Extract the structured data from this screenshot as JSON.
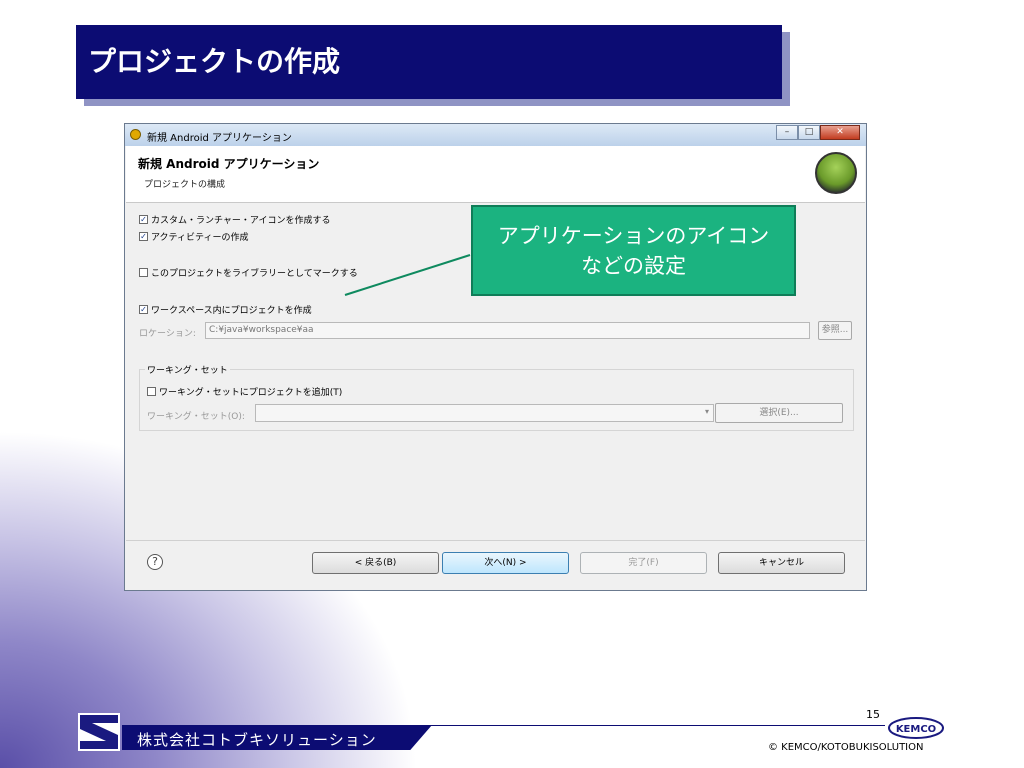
{
  "slide": {
    "title": "プロジェクトの作成",
    "page_number": "15",
    "company_name": "株式会社コトブキソリューション",
    "copyright": "© KEMCO/KOTOBUKISOLUTION",
    "kemco_logo_text": "KEMCO"
  },
  "dialog": {
    "window_title": "新規 Android アプリケーション",
    "window_buttons": {
      "minimize": "–",
      "maximize": "□",
      "close": "✕"
    },
    "banner_title": "新規 Android アプリケーション",
    "banner_subtitle": "プロジェクトの構成",
    "options": {
      "custom_icon": "カスタム・ランチャー・アイコンを作成する",
      "activity": "アクティビティーの作成",
      "library": "このプロジェクトをライブラリーとしてマークする",
      "workspace": "ワークスペース内にプロジェクトを作成"
    },
    "location_label": "ロケーション:",
    "location_value": "C:¥java¥workspace¥aa",
    "browse_label": "参照...",
    "working_set_group": "ワーキング・セット",
    "working_set_add": "ワーキング・セットにプロジェクトを追加(T)",
    "working_set_label": "ワーキング・セット(O):",
    "select_label": "選択(E)...",
    "help_symbol": "?",
    "buttons": {
      "back": "< 戻る(B)",
      "next": "次へ(N) >",
      "finish": "完了(F)",
      "cancel": "キャンセル"
    }
  },
  "callout": {
    "line1": "アプリケーションのアイコン",
    "line2": "などの設定"
  },
  "colors": {
    "title_bar": "#0c0c73",
    "callout": "#1bb380"
  }
}
